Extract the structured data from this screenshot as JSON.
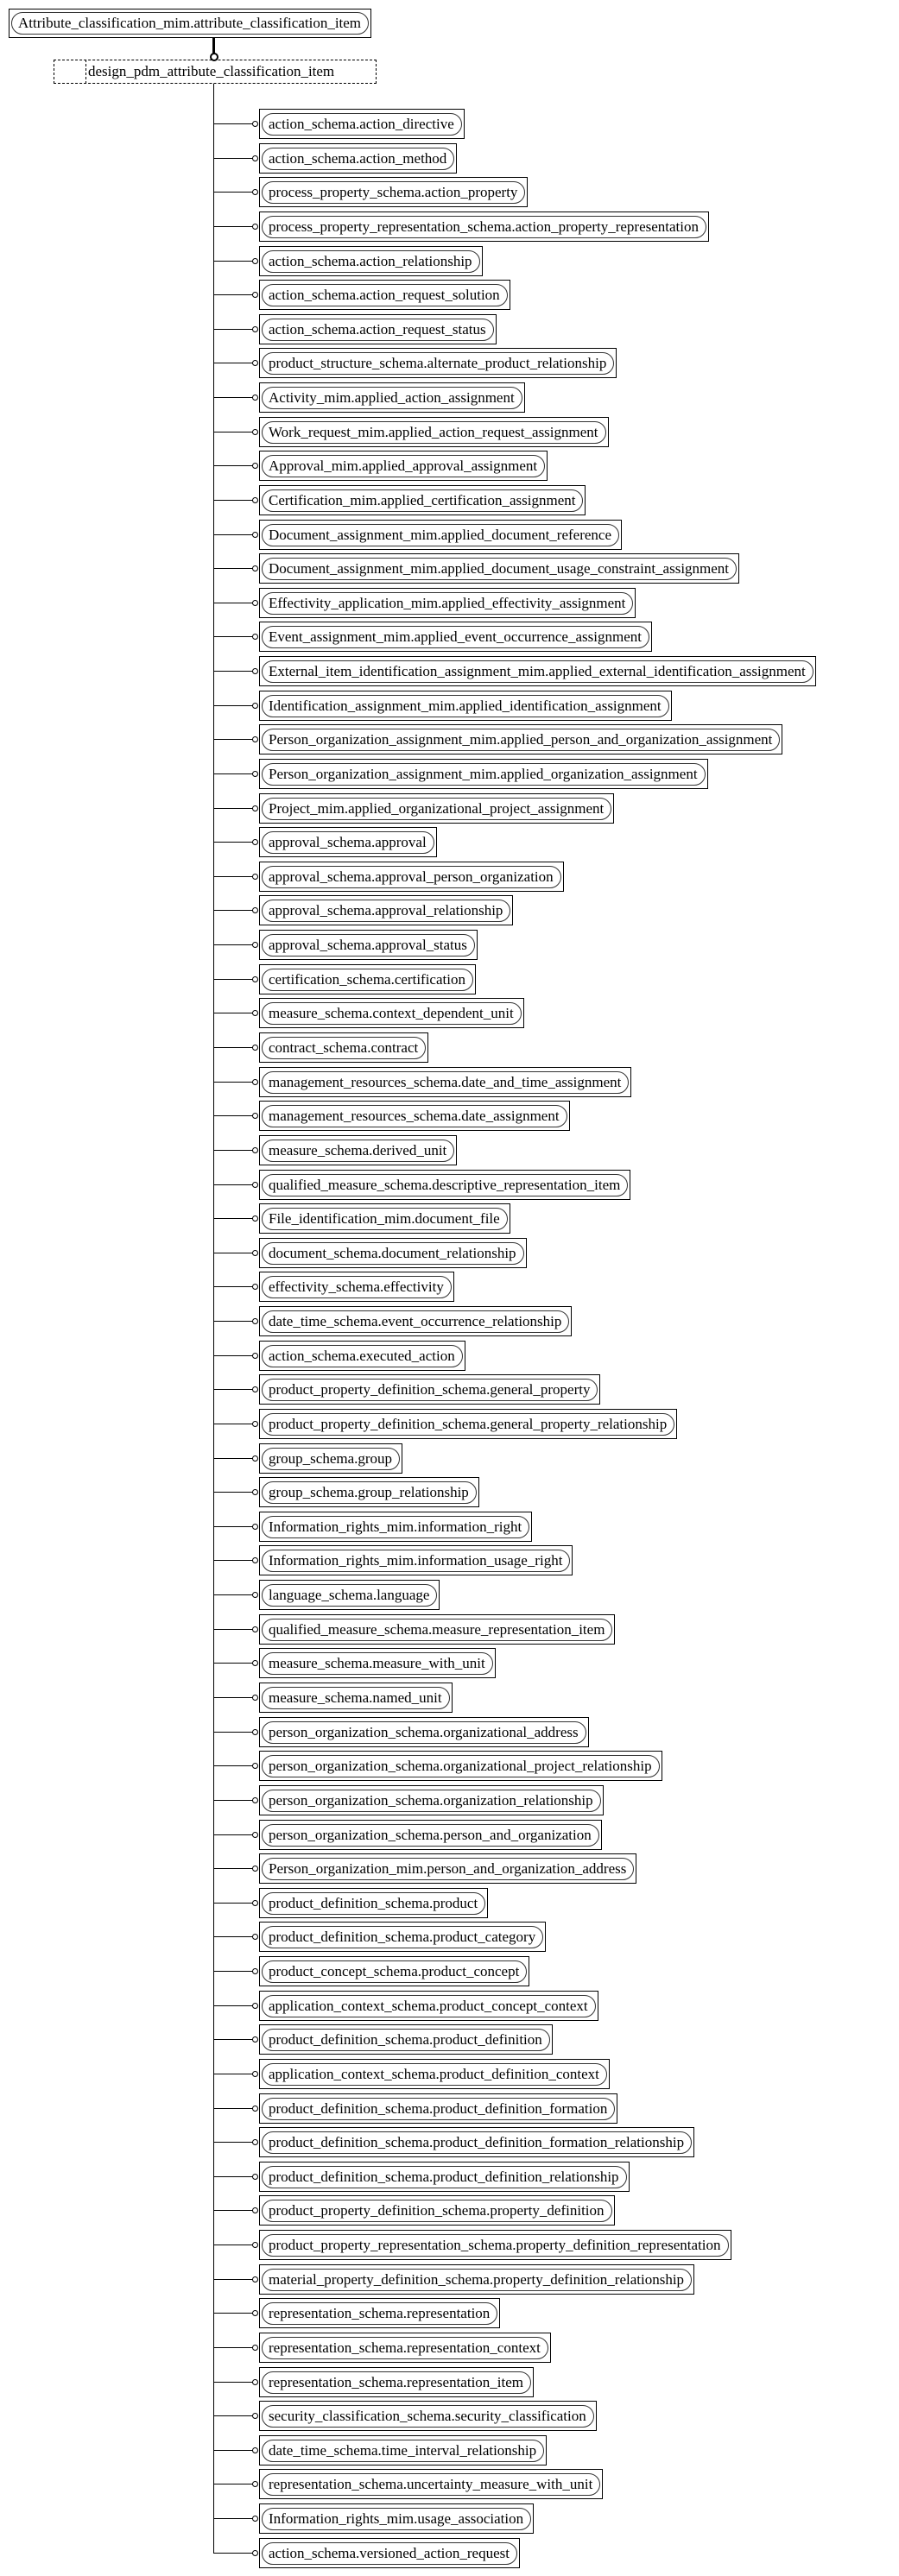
{
  "diagram": {
    "type": "EXPRESS-G select diagram",
    "root": "Attribute_classification_mim.attribute_classification_item",
    "select_type": "design_pdm_attribute_classification_item",
    "items": [
      "action_schema.action_directive",
      "action_schema.action_method",
      "process_property_schema.action_property",
      "process_property_representation_schema.action_property_representation",
      "action_schema.action_relationship",
      "action_schema.action_request_solution",
      "action_schema.action_request_status",
      "product_structure_schema.alternate_product_relationship",
      "Activity_mim.applied_action_assignment",
      "Work_request_mim.applied_action_request_assignment",
      "Approval_mim.applied_approval_assignment",
      "Certification_mim.applied_certification_assignment",
      "Document_assignment_mim.applied_document_reference",
      "Document_assignment_mim.applied_document_usage_constraint_assignment",
      "Effectivity_application_mim.applied_effectivity_assignment",
      "Event_assignment_mim.applied_event_occurrence_assignment",
      "External_item_identification_assignment_mim.applied_external_identification_assignment",
      "Identification_assignment_mim.applied_identification_assignment",
      "Person_organization_assignment_mim.applied_person_and_organization_assignment",
      "Person_organization_assignment_mim.applied_organization_assignment",
      "Project_mim.applied_organizational_project_assignment",
      "approval_schema.approval",
      "approval_schema.approval_person_organization",
      "approval_schema.approval_relationship",
      "approval_schema.approval_status",
      "certification_schema.certification",
      "measure_schema.context_dependent_unit",
      "contract_schema.contract",
      "management_resources_schema.date_and_time_assignment",
      "management_resources_schema.date_assignment",
      "measure_schema.derived_unit",
      "qualified_measure_schema.descriptive_representation_item",
      "File_identification_mim.document_file",
      "document_schema.document_relationship",
      "effectivity_schema.effectivity",
      "date_time_schema.event_occurrence_relationship",
      "action_schema.executed_action",
      "product_property_definition_schema.general_property",
      "product_property_definition_schema.general_property_relationship",
      "group_schema.group",
      "group_schema.group_relationship",
      "Information_rights_mim.information_right",
      "Information_rights_mim.information_usage_right",
      "language_schema.language",
      "qualified_measure_schema.measure_representation_item",
      "measure_schema.measure_with_unit",
      "measure_schema.named_unit",
      "person_organization_schema.organizational_address",
      "person_organization_schema.organizational_project_relationship",
      "person_organization_schema.organization_relationship",
      "person_organization_schema.person_and_organization",
      "Person_organization_mim.person_and_organization_address",
      "product_definition_schema.product",
      "product_definition_schema.product_category",
      "product_concept_schema.product_concept",
      "application_context_schema.product_concept_context",
      "product_definition_schema.product_definition",
      "application_context_schema.product_definition_context",
      "product_definition_schema.product_definition_formation",
      "product_definition_schema.product_definition_formation_relationship",
      "product_definition_schema.product_definition_relationship",
      "product_property_definition_schema.property_definition",
      "product_property_representation_schema.property_definition_representation",
      "material_property_definition_schema.property_definition_relationship",
      "representation_schema.representation",
      "representation_schema.representation_context",
      "representation_schema.representation_item",
      "security_classification_schema.security_classification",
      "date_time_schema.time_interval_relationship",
      "representation_schema.uncertainty_measure_with_unit",
      "Information_rights_mim.usage_association",
      "action_schema.versioned_action_request"
    ]
  }
}
